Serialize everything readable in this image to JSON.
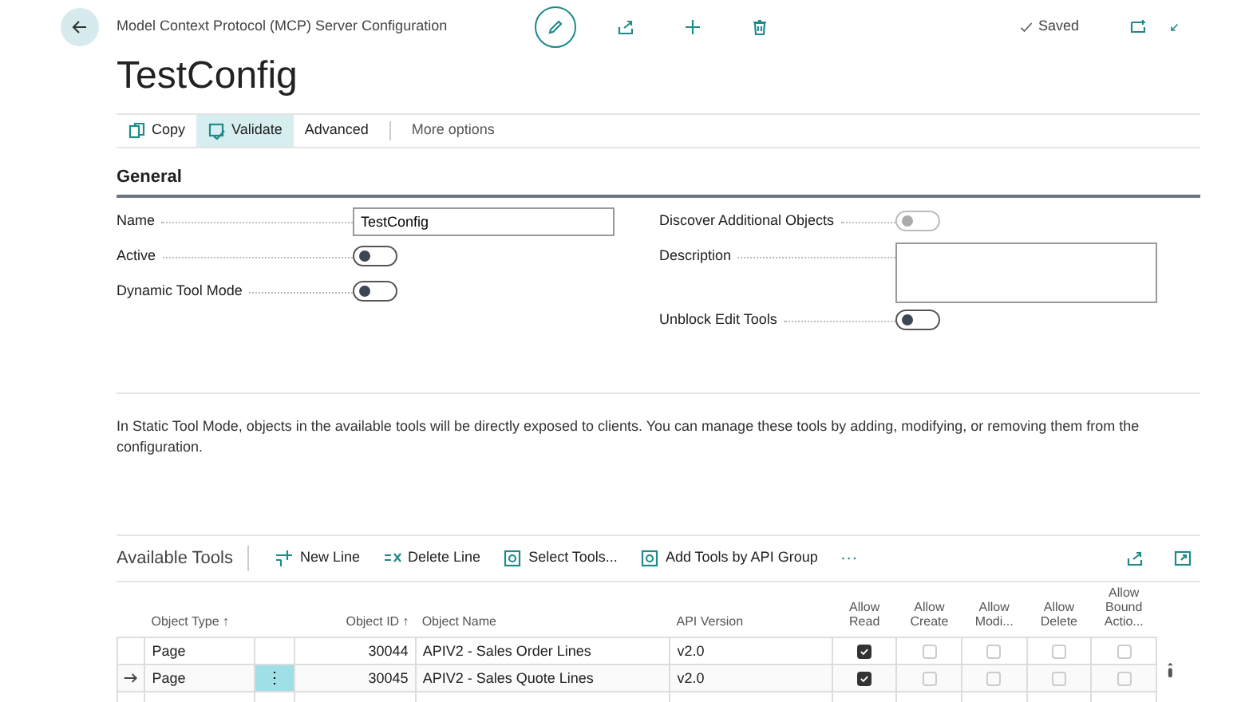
{
  "header": {
    "breadcrumb": "Model Context Protocol (MCP) Server Configuration",
    "saved": "Saved"
  },
  "title": "TestConfig",
  "actions": [
    {
      "label": "Copy",
      "selected": false
    },
    {
      "label": "Validate",
      "selected": true
    },
    {
      "label": "Advanced",
      "selected": false
    },
    {
      "label": "More options",
      "selected": false
    }
  ],
  "general": {
    "title": "General",
    "left": [
      {
        "label": "Name",
        "kind": "text",
        "value": "TestConfig"
      },
      {
        "label": "Active",
        "kind": "toggle",
        "on": false,
        "disabled": false
      },
      {
        "label": "Dynamic Tool Mode",
        "kind": "toggle",
        "on": false,
        "disabled": false
      }
    ],
    "right": [
      {
        "label": "Discover Additional Objects",
        "kind": "toggle",
        "on": false,
        "disabled": true
      },
      {
        "label": "Description",
        "kind": "textarea"
      },
      {
        "label": "Unblock Edit Tools",
        "kind": "toggle",
        "on": false,
        "disabled": false
      }
    ]
  },
  "info": "In Static Tool Mode, objects in the available tools will be directly exposed to clients. You can manage these tools by adding, modifying, or removing them from the configuration.",
  "tools": {
    "title": "Available Tools",
    "actions": [
      {
        "label": "New Line"
      },
      {
        "label": "Delete Line"
      },
      {
        "label": "Select Tools..."
      },
      {
        "label": "Add Tools by API Group"
      }
    ],
    "row_menu": "⋮",
    "more": "···",
    "columns": [
      "Object Type ↑",
      "Object ID ↑",
      "Object Name",
      "API Version",
      "Allow Read",
      "Allow Create",
      "Allow Modi...",
      "Allow Delete",
      "Allow Bound Actio..."
    ],
    "rows": [
      {
        "selected": false,
        "type": "Page",
        "id": "30044",
        "name": "APIV2 - Sales Order Lines",
        "version": "v2.0",
        "checks": [
          true,
          false,
          false,
          false,
          false
        ]
      },
      {
        "selected": true,
        "type": "Page",
        "id": "30045",
        "name": "APIV2 - Sales Quote Lines",
        "version": "v2.0",
        "checks": [
          true,
          false,
          false,
          false,
          false
        ]
      }
    ]
  }
}
